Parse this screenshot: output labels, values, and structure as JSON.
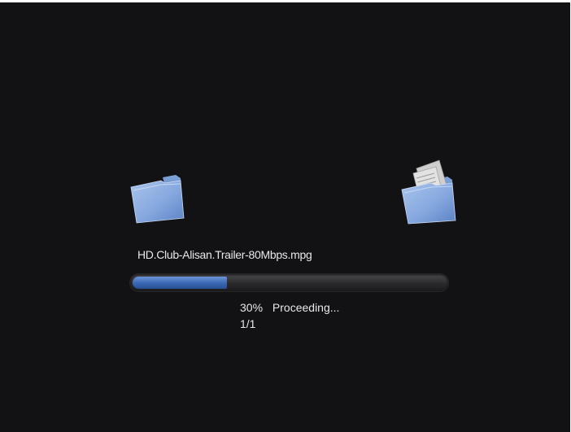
{
  "transfer": {
    "filename": "HD.Club-Alisan.Trailer-80Mbps.mpg",
    "progress_percent": 30,
    "percent_label": "30%",
    "status_label": "Proceeding...",
    "count_label": "1/1"
  },
  "icons": {
    "source": "folder-icon",
    "destination": "folder-with-files-icon"
  },
  "colors": {
    "background": "#121114",
    "progress_fill": "#3a67b4",
    "text": "#e8e8e8"
  }
}
